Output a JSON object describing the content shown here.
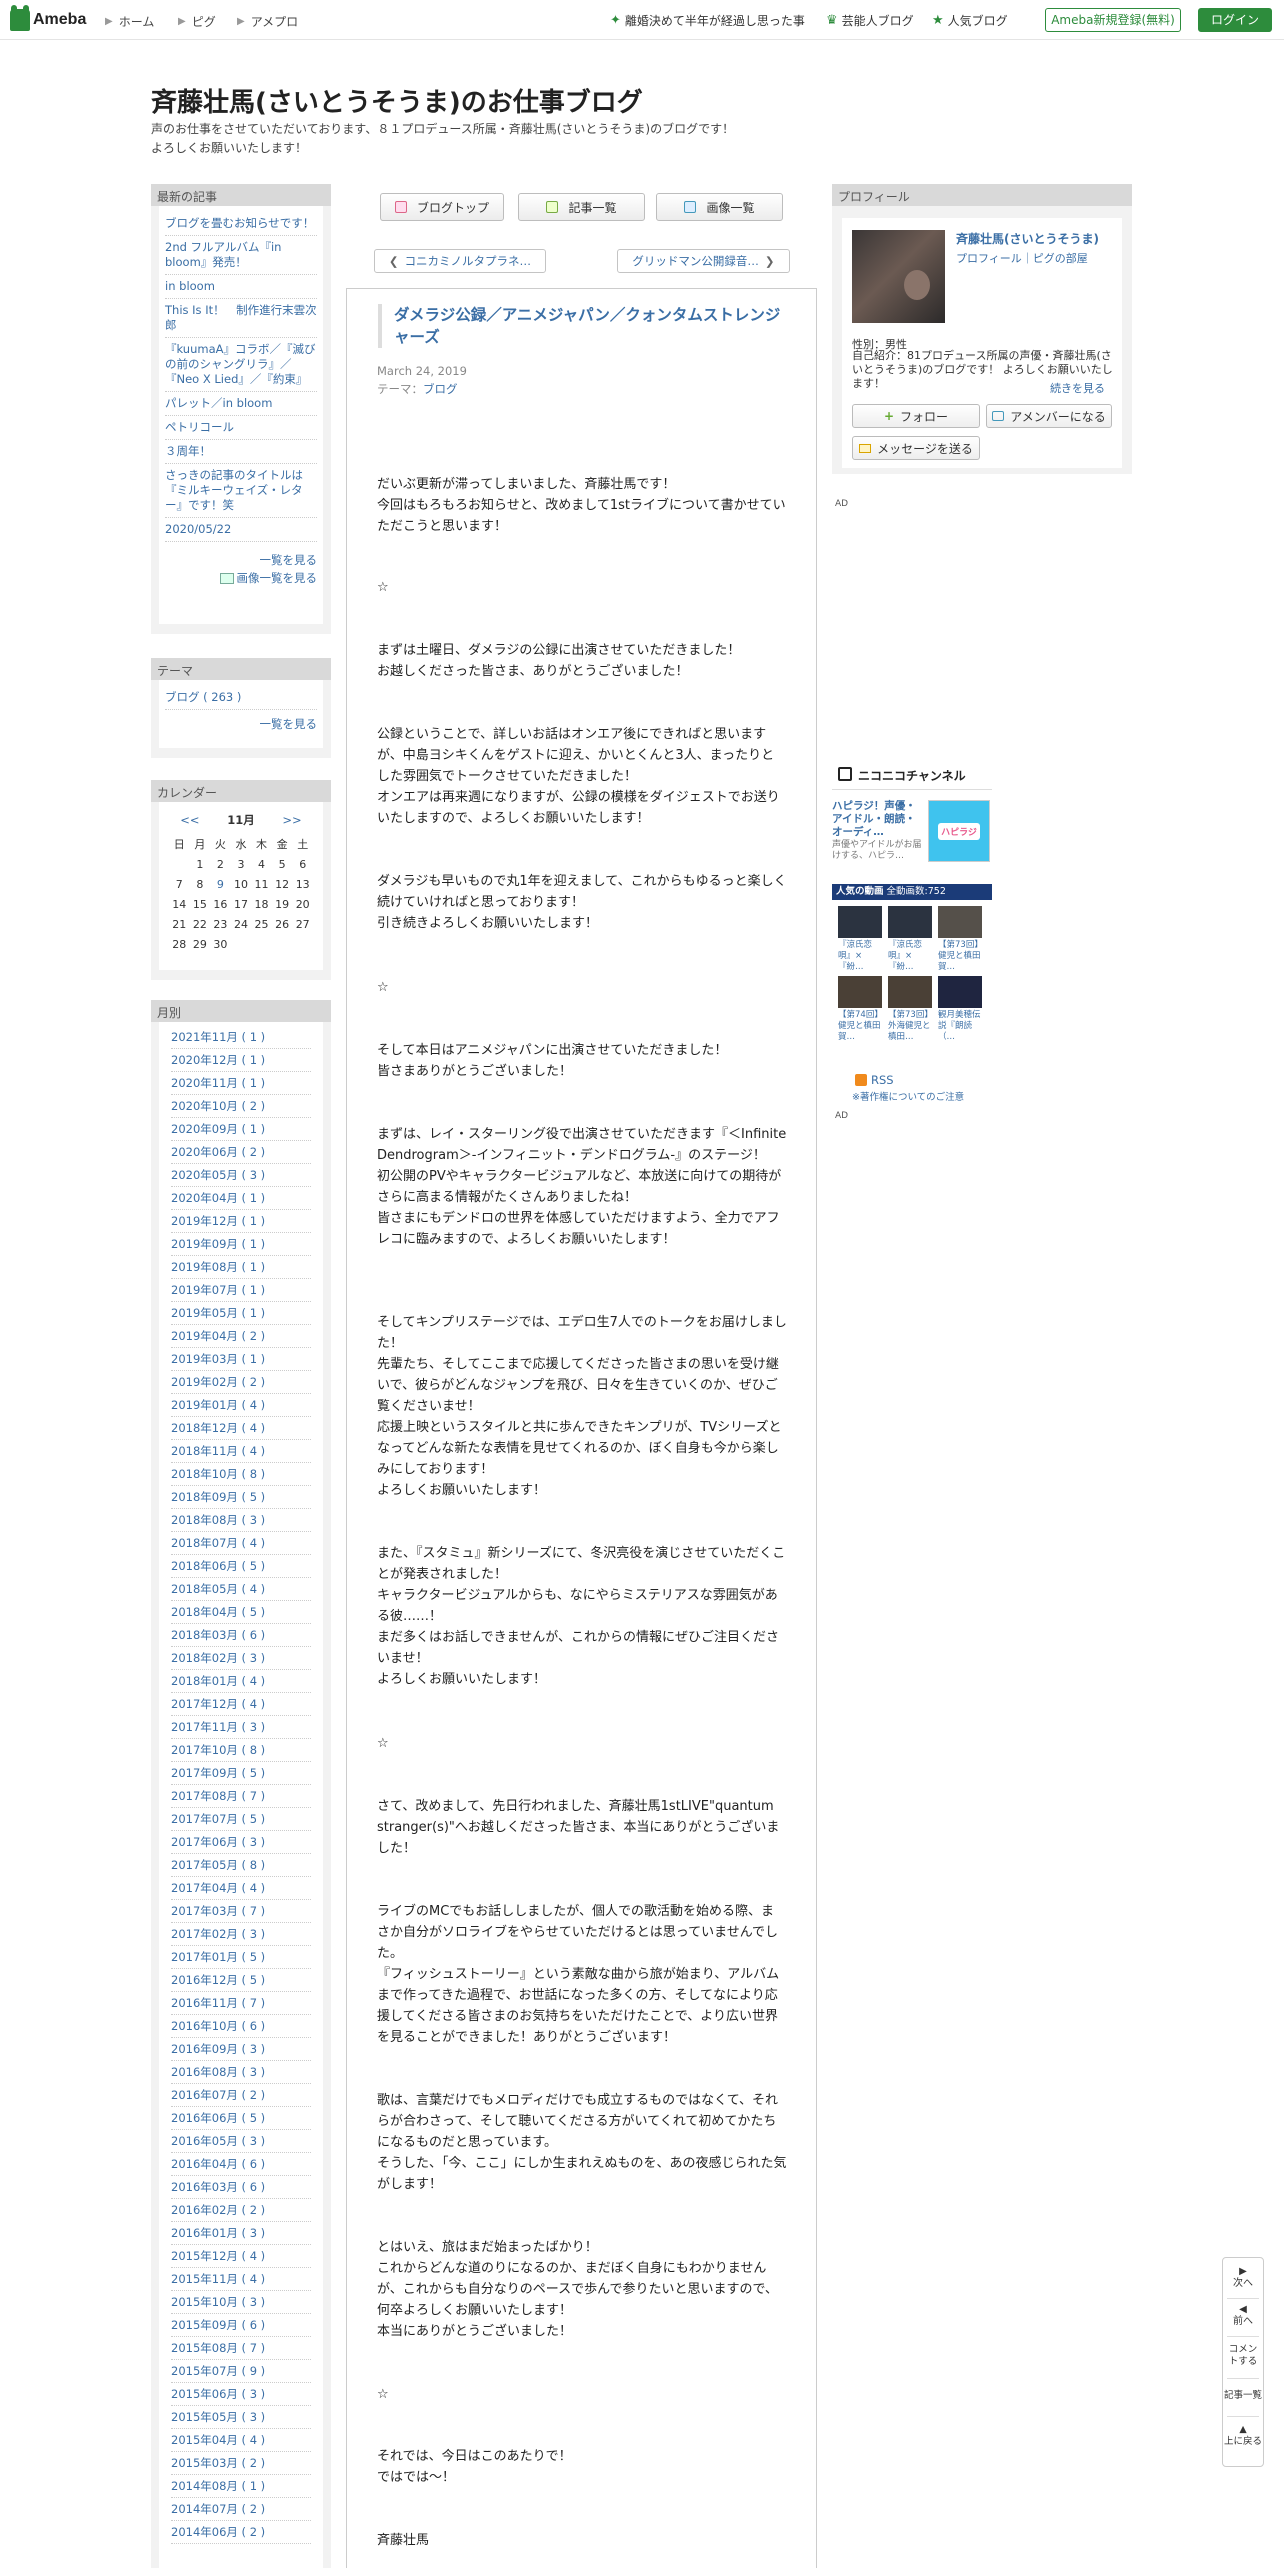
{
  "topbar": {
    "logo": "Ameba",
    "nav": [
      "ホーム",
      "ピグ",
      "アメプロ"
    ],
    "links": [
      "離婚決めて半年が経過し思った事",
      "芸能人ブログ",
      "人気ブログ"
    ],
    "signup": "Ameba新規登録(無料)",
    "login": "ログイン"
  },
  "header": {
    "title": "斉藤壮馬(さいとうそうま)のお仕事ブログ",
    "desc_line1": "声のお仕事をさせていただいております、８１プロデュース所属・斉藤壮馬(さいとうそうま)のブログです！",
    "desc_line2": "よろしくお願いいたします！"
  },
  "recent": {
    "heading": "最新の記事",
    "items": [
      "ブログを畳むお知らせです！",
      "2nd フルアルバム『in bloom』発売！",
      "in bloom",
      "This Is It！　制作進行末雲次郎",
      "『kuumaA』コラボ／『滅びの前のシャングリラ』／『Neo X Lied』／『約束』",
      "パレット／in bloom",
      "ペトリコール",
      "３周年！",
      "さっきの記事のタイトルは『ミルキーウェイズ・レター』です！笑",
      "2020/05/22"
    ],
    "more": "一覧を見る",
    "images_more": "画像一覧を見る"
  },
  "theme": {
    "heading": "テーマ",
    "item": "ブログ ( 263 )",
    "more": "一覧を見る"
  },
  "calendar": {
    "heading": "カレンダー",
    "prev": "<<",
    "month": "11月",
    "next": ">>",
    "weekdays": [
      "日",
      "月",
      "火",
      "水",
      "木",
      "金",
      "土"
    ],
    "rows": [
      [
        "",
        "1",
        "2",
        "3",
        "4",
        "5",
        "6"
      ],
      [
        "7",
        "8",
        "9",
        "10",
        "11",
        "12",
        "13"
      ],
      [
        "14",
        "15",
        "16",
        "17",
        "18",
        "19",
        "20"
      ],
      [
        "21",
        "22",
        "23",
        "24",
        "25",
        "26",
        "27"
      ],
      [
        "28",
        "29",
        "30",
        "",
        "",
        "",
        ""
      ]
    ]
  },
  "monthly": {
    "heading": "月別",
    "items": [
      "2021年11月 ( 1 )",
      "2020年12月 ( 1 )",
      "2020年11月 ( 1 )",
      "2020年10月 ( 2 )",
      "2020年09月 ( 1 )",
      "2020年06月 ( 2 )",
      "2020年05月 ( 3 )",
      "2020年04月 ( 1 )",
      "2019年12月 ( 1 )",
      "2019年09月 ( 1 )",
      "2019年08月 ( 1 )",
      "2019年07月 ( 1 )",
      "2019年05月 ( 1 )",
      "2019年04月 ( 2 )",
      "2019年03月 ( 1 )",
      "2019年02月 ( 2 )",
      "2019年01月 ( 4 )",
      "2018年12月 ( 4 )",
      "2018年11月 ( 4 )",
      "2018年10月 ( 8 )",
      "2018年09月 ( 5 )",
      "2018年08月 ( 3 )",
      "2018年07月 ( 4 )",
      "2018年06月 ( 5 )",
      "2018年05月 ( 4 )",
      "2018年04月 ( 5 )",
      "2018年03月 ( 6 )",
      "2018年02月 ( 3 )",
      "2018年01月 ( 4 )",
      "2017年12月 ( 4 )",
      "2017年11月 ( 3 )",
      "2017年10月 ( 8 )",
      "2017年09月 ( 5 )",
      "2017年08月 ( 7 )",
      "2017年07月 ( 5 )",
      "2017年06月 ( 3 )",
      "2017年05月 ( 8 )",
      "2017年04月 ( 4 )",
      "2017年03月 ( 7 )",
      "2017年02月 ( 3 )",
      "2017年01月 ( 5 )",
      "2016年12月 ( 5 )",
      "2016年11月 ( 7 )",
      "2016年10月 ( 6 )",
      "2016年09月 ( 3 )",
      "2016年08月 ( 3 )",
      "2016年07月 ( 2 )",
      "2016年06月 ( 5 )",
      "2016年05月 ( 3 )",
      "2016年04月 ( 6 )",
      "2016年03月 ( 6 )",
      "2016年02月 ( 2 )",
      "2016年01月 ( 3 )",
      "2015年12月 ( 4 )",
      "2015年11月 ( 4 )",
      "2015年10月 ( 3 )",
      "2015年09月 ( 6 )",
      "2015年08月 ( 7 )",
      "2015年07月 ( 9 )",
      "2015年06月 ( 3 )",
      "2015年05月 ( 3 )",
      "2015年04月 ( 4 )",
      "2015年03月 ( 2 )",
      "2014年08月 ( 1 )",
      "2014年07月 ( 2 )",
      "2014年06月 ( 2 )"
    ]
  },
  "toolbar": {
    "blog_top": "ブログトップ",
    "articles": "記事一覧",
    "images": "画像一覧"
  },
  "pager": {
    "prev": "コニカミノルタプラネ…",
    "next": "グリッドマン公開録音…"
  },
  "post": {
    "title": "ダメラジ公録／アニメジャパン／クォンタムストレンジャーズ",
    "date": "March 24, 2019",
    "theme_label": "テーマ：",
    "theme": "ブログ",
    "paras": [
      "だいぶ更新が滞ってしまいました、斉藤壮馬です！\n今回はもろもろお知らせと、改めまして1stライブについて書かせていただこうと思います！",
      "☆",
      "まずは土曜日、ダメラジの公録に出演させていただきました！\nお越しくださった皆さま、ありがとうございました！",
      "公録ということで、詳しいお話はオンエア後にできればと思いますが、中島ヨシキくんをゲストに迎え、かいとくんと3人、まったりとした雰囲気でトークさせていただきました！\nオンエアは再来週になりますが、公録の模様をダイジェストでお送りいたしますので、よろしくお願いいたします！",
      "ダメラジも早いもので丸1年を迎えまして、これからもゆるっと楽しく続けていければと思っております！\n引き続きよろしくお願いいたします！",
      "☆",
      "そして本日はアニメジャパンに出演させていただきました！\n皆さまありがとうございました！",
      "まずは、レイ・スターリング役で出演させていただきます『＜Infinite Dendrogram＞-インフィニット・デンドログラム-』のステージ！\n初公開のPVやキャラクタービジュアルなど、本放送に向けての期待がさらに高まる情報がたくさんありましたね！\n皆さまにもデンドロの世界を体感していただけますよう、全力でアフレコに臨みますので、よろしくお願いいたします！",
      "そしてキンプリステージでは、エデロ生7人でのトークをお届けしました！\n先輩たち、そしてここまで応援してくださった皆さまの思いを受け継いで、彼らがどんなジャンプを飛び、日々を生きていくのか、ぜひご覧くださいませ！\n応援上映というスタイルと共に歩んできたキンプリが、TVシリーズとなってどんな新たな表情を見せてくれるのか、ぼく自身も今から楽しみにしております！\nよろしくお願いいたします！",
      "また、『スタミュ』新シリーズにて、冬沢亮役を演じさせていただくことが発表されました！\nキャラクタービジュアルからも、なにやらミステリアスな雰囲気がある彼……！\nまだ多くはお話しできませんが、これからの情報にぜひご注目くださいませ！\nよろしくお願いいたします！",
      "☆",
      "さて、改めまして、先日行われました、斉藤壮馬1stLIVE\"quantum stranger(s)\"へお越しくださった皆さま、本当にありがとうございました！",
      "ライブのMCでもお話ししましたが、個人での歌活動を始める際、まさか自分がソロライブをやらせていただけるとは思っていませんでした。\n『フィッシュストーリー』という素敵な曲から旅が始まり、アルバムまで作ってきた過程で、お世話になった多くの方、そしてなにより応援してくださる皆さまのお気持ちをいただけたことで、より広い世界を見ることができました！ありがとうございます！",
      "歌は、言葉だけでもメロディだけでも成立するものではなくて、それらが合わさって、そして聴いてくださる方がいてくれて初めてかたちになるものだと思っています。\nそうした、「今、ここ」にしか生まれえぬものを、あの夜感じられた気がします！",
      "とはいえ、旅はまだ始まったばかり！\nこれからどんな道のりになるのか、まだぼく自身にもわかりませんが、これからも自分なりのペースで歩んで参りたいと思いますので、何卒よろしくお願いいたします！\n本当にありがとうございました！",
      "☆",
      "それでは、今日はこのあたりで！\nではでは～！",
      "斉藤壮馬"
    ]
  },
  "profile": {
    "heading": "プロフィール",
    "name": "斉藤壮馬(さいとうそうま)",
    "links": "プロフィール｜ピグの部屋",
    "gender": "性別：男性",
    "intro": "自己紹介：81プロデュース所属の声優・斉藤壮馬(さいとうそうま)のブログです！ よろしくお願いいたします！",
    "more": "続きを見る",
    "follow": "フォロー",
    "member": "アメンバーになる",
    "message": "メッセージを送る"
  },
  "ad1": "AD",
  "ad2": "AD",
  "nico": {
    "brand": "ニコニコチャンネル",
    "title": "ハピラジ！声優・アイドル・朗読・オーディ…",
    "desc": "声優やアイドルがお届けする、ハピラ…",
    "thumb_label": "ハピラジ",
    "bar": "人気の動画",
    "count": "全動画数:752",
    "caps": [
      "『涼氏恋唄』×『紛…",
      "『涼氏恋唄』×『紛…",
      "【第73回】健児と槙田賀…",
      "【第74回】健児と槙田賀…",
      "【第73回】外海健児と槙田…",
      "観月美穂伝説『朗読（…"
    ]
  },
  "rss": "RSS",
  "copyright_note": "※著作権についてのご注意",
  "floatnav": [
    "次へ",
    "前へ",
    "コメントする",
    "記事一覧",
    "上に戻る"
  ]
}
